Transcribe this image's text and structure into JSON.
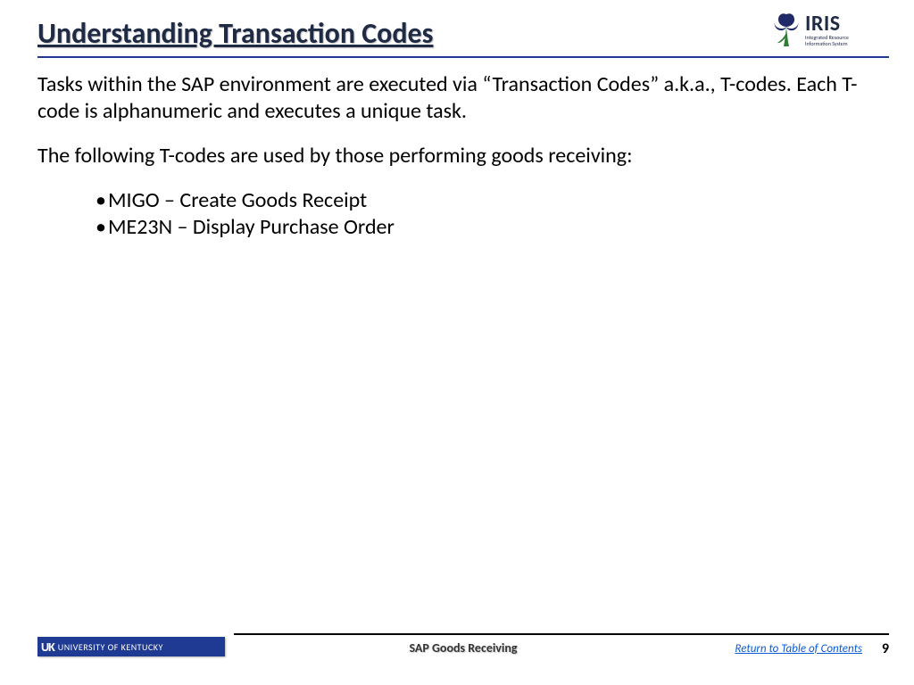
{
  "header": {
    "title": "Understanding Transaction Codes",
    "logo": {
      "name": "IRIS",
      "sub1": "Integrated Resource",
      "sub2": "Information System"
    }
  },
  "body": {
    "para1": "Tasks within the SAP environment are executed via “Transaction Codes” a.k.a., T-codes. Each T-code is alphanumeric and executes a unique task.",
    "para2": "The following T-codes are used by those performing goods receiving:",
    "bullets": [
      "MIGO – Create Goods Receipt",
      "ME23N – Display Purchase Order"
    ]
  },
  "footer": {
    "badge_uk": "UK",
    "badge_name": "UNIVERSITY OF KENTUCKY",
    "center": "SAP Goods Receiving",
    "link": "Return to Table of Contents",
    "page": "9"
  }
}
